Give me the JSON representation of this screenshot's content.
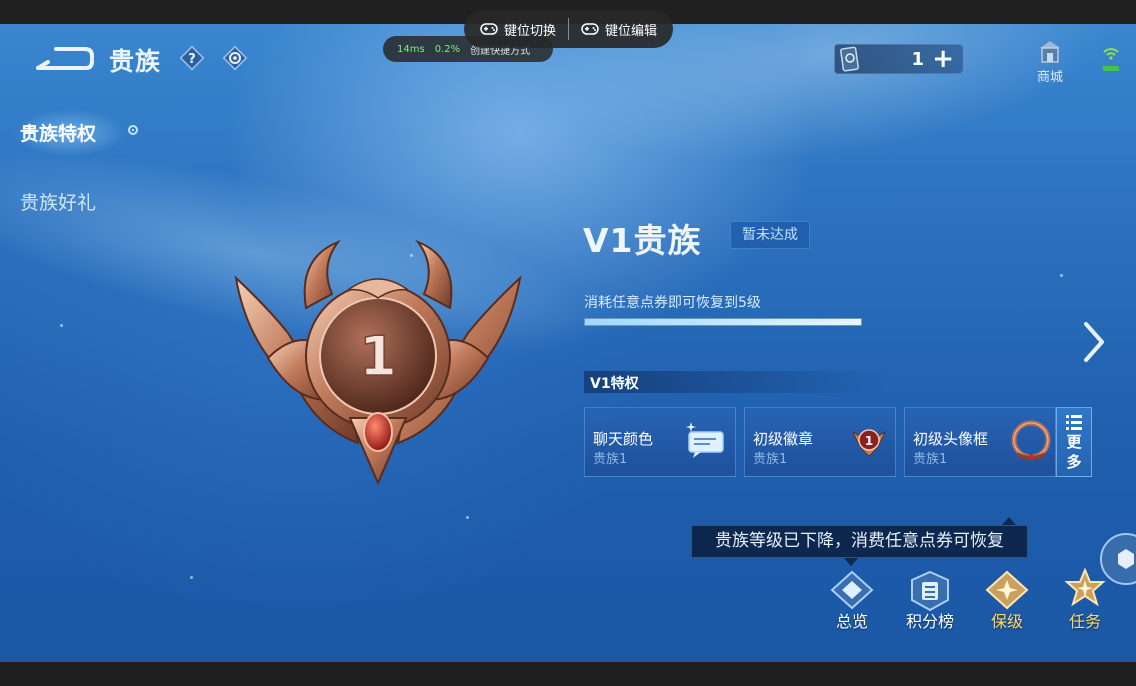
{
  "overlay": {
    "key_switch": "键位切换",
    "key_edit": "键位编辑",
    "ping": "14ms",
    "loss": "0.2%",
    "shortcut": "创建快捷方式"
  },
  "header": {
    "title": "贵族",
    "ticket_count": "1",
    "shop_label": "商城"
  },
  "nav": {
    "items": [
      {
        "label": "贵族特权",
        "selected": true
      },
      {
        "label": "贵族好礼",
        "selected": false
      }
    ]
  },
  "badge": {
    "level": "1"
  },
  "info": {
    "title": "V1贵族",
    "status": "暂未达成",
    "hint": "消耗任意点券即可恢复到5级",
    "progress": 1.0
  },
  "privileges": {
    "heading": "V1特权",
    "items": [
      {
        "name": "聊天颜色",
        "sub": "贵族1",
        "icon": "chat-bubble-icon"
      },
      {
        "name": "初级徽章",
        "sub": "贵族1",
        "icon": "badge-icon"
      },
      {
        "name": "初级头像框",
        "sub": "贵族1",
        "icon": "avatar-frame-icon"
      }
    ],
    "more": [
      "更",
      "多"
    ]
  },
  "tooltip": "贵族等级已下降，消费任意点券可恢复",
  "tabs": [
    {
      "label": "总览",
      "icon": "overview-icon",
      "color": "#ffffff"
    },
    {
      "label": "积分榜",
      "icon": "leaderboard-icon",
      "color": "#ffffff"
    },
    {
      "label": "保级",
      "icon": "keep-level-icon",
      "color": "#ffd86a"
    },
    {
      "label": "任务",
      "icon": "task-icon",
      "color": "#ffd86a"
    }
  ],
  "colors": {
    "accent_gold": "#ffd86a",
    "bg_blue": "#2a6fbc"
  }
}
